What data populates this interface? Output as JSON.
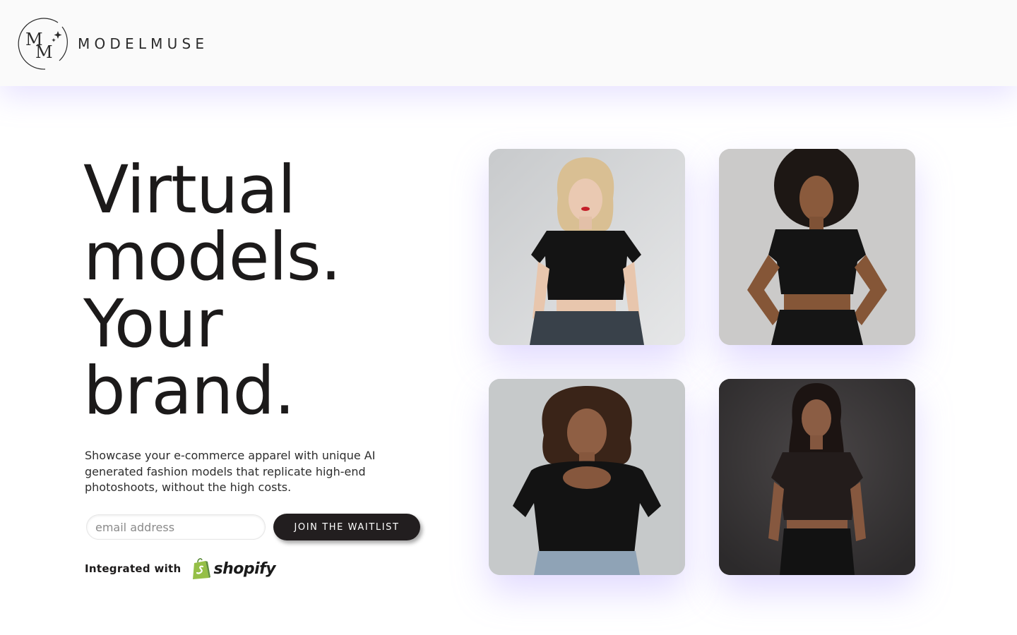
{
  "brand": {
    "monogram": "MM",
    "wordmark": "MODELMUSE"
  },
  "hero": {
    "headline_lines": [
      "Virtual",
      "models.",
      "Your",
      "brand."
    ],
    "subtext": "Showcase your e-commerce apparel with unique AI generated fashion models that replicate high-end photoshoots, without the high costs.",
    "email_placeholder": "email address",
    "cta_label": "JOIN THE WAITLIST",
    "integrated_label": "Integrated with",
    "partner_name": "shopify"
  },
  "colors": {
    "text_dark": "#1c1a1a",
    "button_bg": "#221e1f",
    "glow": "#b4a0ff",
    "shopify_green": "#95bf47"
  },
  "gallery": {
    "images": [
      {
        "icon": "model-photo-blonde"
      },
      {
        "icon": "model-photo-afro"
      },
      {
        "icon": "model-photo-curly"
      },
      {
        "icon": "model-photo-dark-backdrop"
      }
    ]
  }
}
